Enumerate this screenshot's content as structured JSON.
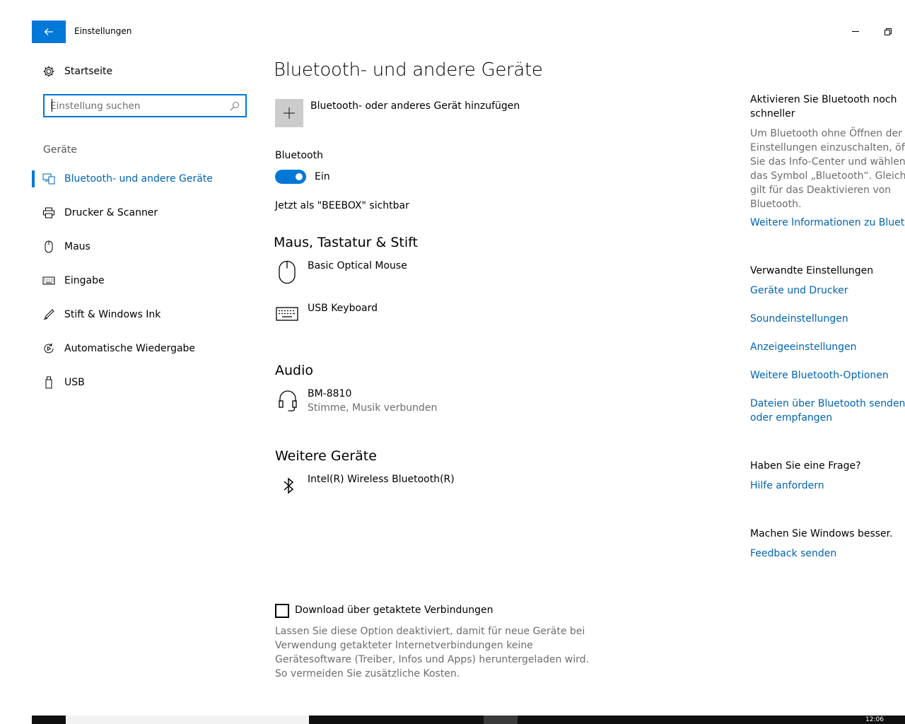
{
  "window": {
    "title": "Einstellungen",
    "back_icon": "arrow-left-icon",
    "minimize_icon": "minimize-icon",
    "restore_icon": "restore-icon"
  },
  "sidebar": {
    "home": {
      "label": "Startseite",
      "icon": "gear-icon"
    },
    "search": {
      "value": "",
      "placeholder": "Einstellung suchen",
      "icon": "search-icon"
    },
    "section_label": "Geräte",
    "items": [
      {
        "label": "Bluetooth- und andere Geräte",
        "icon": "bluetooth-devices-icon",
        "active": true
      },
      {
        "label": "Drucker & Scanner",
        "icon": "printer-icon",
        "active": false
      },
      {
        "label": "Maus",
        "icon": "mouse-icon",
        "active": false
      },
      {
        "label": "Eingabe",
        "icon": "keyboard-icon",
        "active": false
      },
      {
        "label": "Stift & Windows Ink",
        "icon": "pen-icon",
        "active": false
      },
      {
        "label": "Automatische Wiedergabe",
        "icon": "autoplay-icon",
        "active": false
      },
      {
        "label": "USB",
        "icon": "usb-icon",
        "active": false
      }
    ]
  },
  "main": {
    "title": "Bluetooth- und andere Geräte",
    "add_device": {
      "label": "Bluetooth- oder anderes Gerät hinzufügen",
      "icon": "plus-icon"
    },
    "bluetooth": {
      "label": "Bluetooth",
      "state": "Ein",
      "on": true,
      "visible_as": "Jetzt als \"BEEBOX\" sichtbar"
    },
    "groups": [
      {
        "title": "Maus, Tastatur & Stift",
        "devices": [
          {
            "name": "Basic Optical Mouse",
            "status": "",
            "icon": "mouse-icon"
          },
          {
            "name": "USB Keyboard",
            "status": "",
            "icon": "keyboard-icon"
          }
        ]
      },
      {
        "title": "Audio",
        "devices": [
          {
            "name": "BM-8810",
            "status": "Stimme, Musik verbunden",
            "icon": "headset-icon"
          }
        ]
      },
      {
        "title": "Weitere Geräte",
        "devices": [
          {
            "name": "Intel(R) Wireless Bluetooth(R)",
            "status": "",
            "icon": "bluetooth-icon"
          }
        ]
      }
    ],
    "metered_download": {
      "label": "Download über getaktete Verbindungen",
      "checked": false,
      "description": "Lassen Sie diese Option deaktiviert, damit für neue Geräte bei Verwendung getakteter Internetverbindungen keine Gerätesoftware (Treiber, Infos und Apps) heruntergeladen wird. So vermeiden Sie zusätzliche Kosten."
    }
  },
  "right_panel": {
    "quick_bt": {
      "heading_line1": "Aktivieren Sie Bluetooth noch",
      "heading_line2": "schneller",
      "text_lines": [
        "Um Bluetooth ohne Öffnen der",
        "Einstellungen einzuschalten, öffne",
        "Sie das Info-Center und wählen d",
        "das Symbol „Bluetooth“. Gleiches",
        "gilt für das Deaktivieren von",
        "Bluetooth."
      ],
      "link": "Weitere Informationen zu Bluetoo"
    },
    "related": {
      "heading": "Verwandte Einstellungen",
      "links": [
        "Geräte und Drucker",
        "Soundeinstellungen",
        "Anzeigeeinstellungen",
        "Weitere Bluetooth-Optionen"
      ],
      "last_link_line1": "Dateien über Bluetooth senden",
      "last_link_line2": "oder empfangen"
    },
    "question": {
      "heading": "Haben Sie eine Frage?",
      "link": "Hilfe anfordern"
    },
    "feedback": {
      "heading": "Machen Sie Windows besser.",
      "link": "Feedback senden"
    }
  },
  "taskbar": {
    "clock": "12:06"
  },
  "colors": {
    "accent": "#0078d7",
    "link": "#0063b1",
    "secondary_text": "#6d6d6d"
  }
}
